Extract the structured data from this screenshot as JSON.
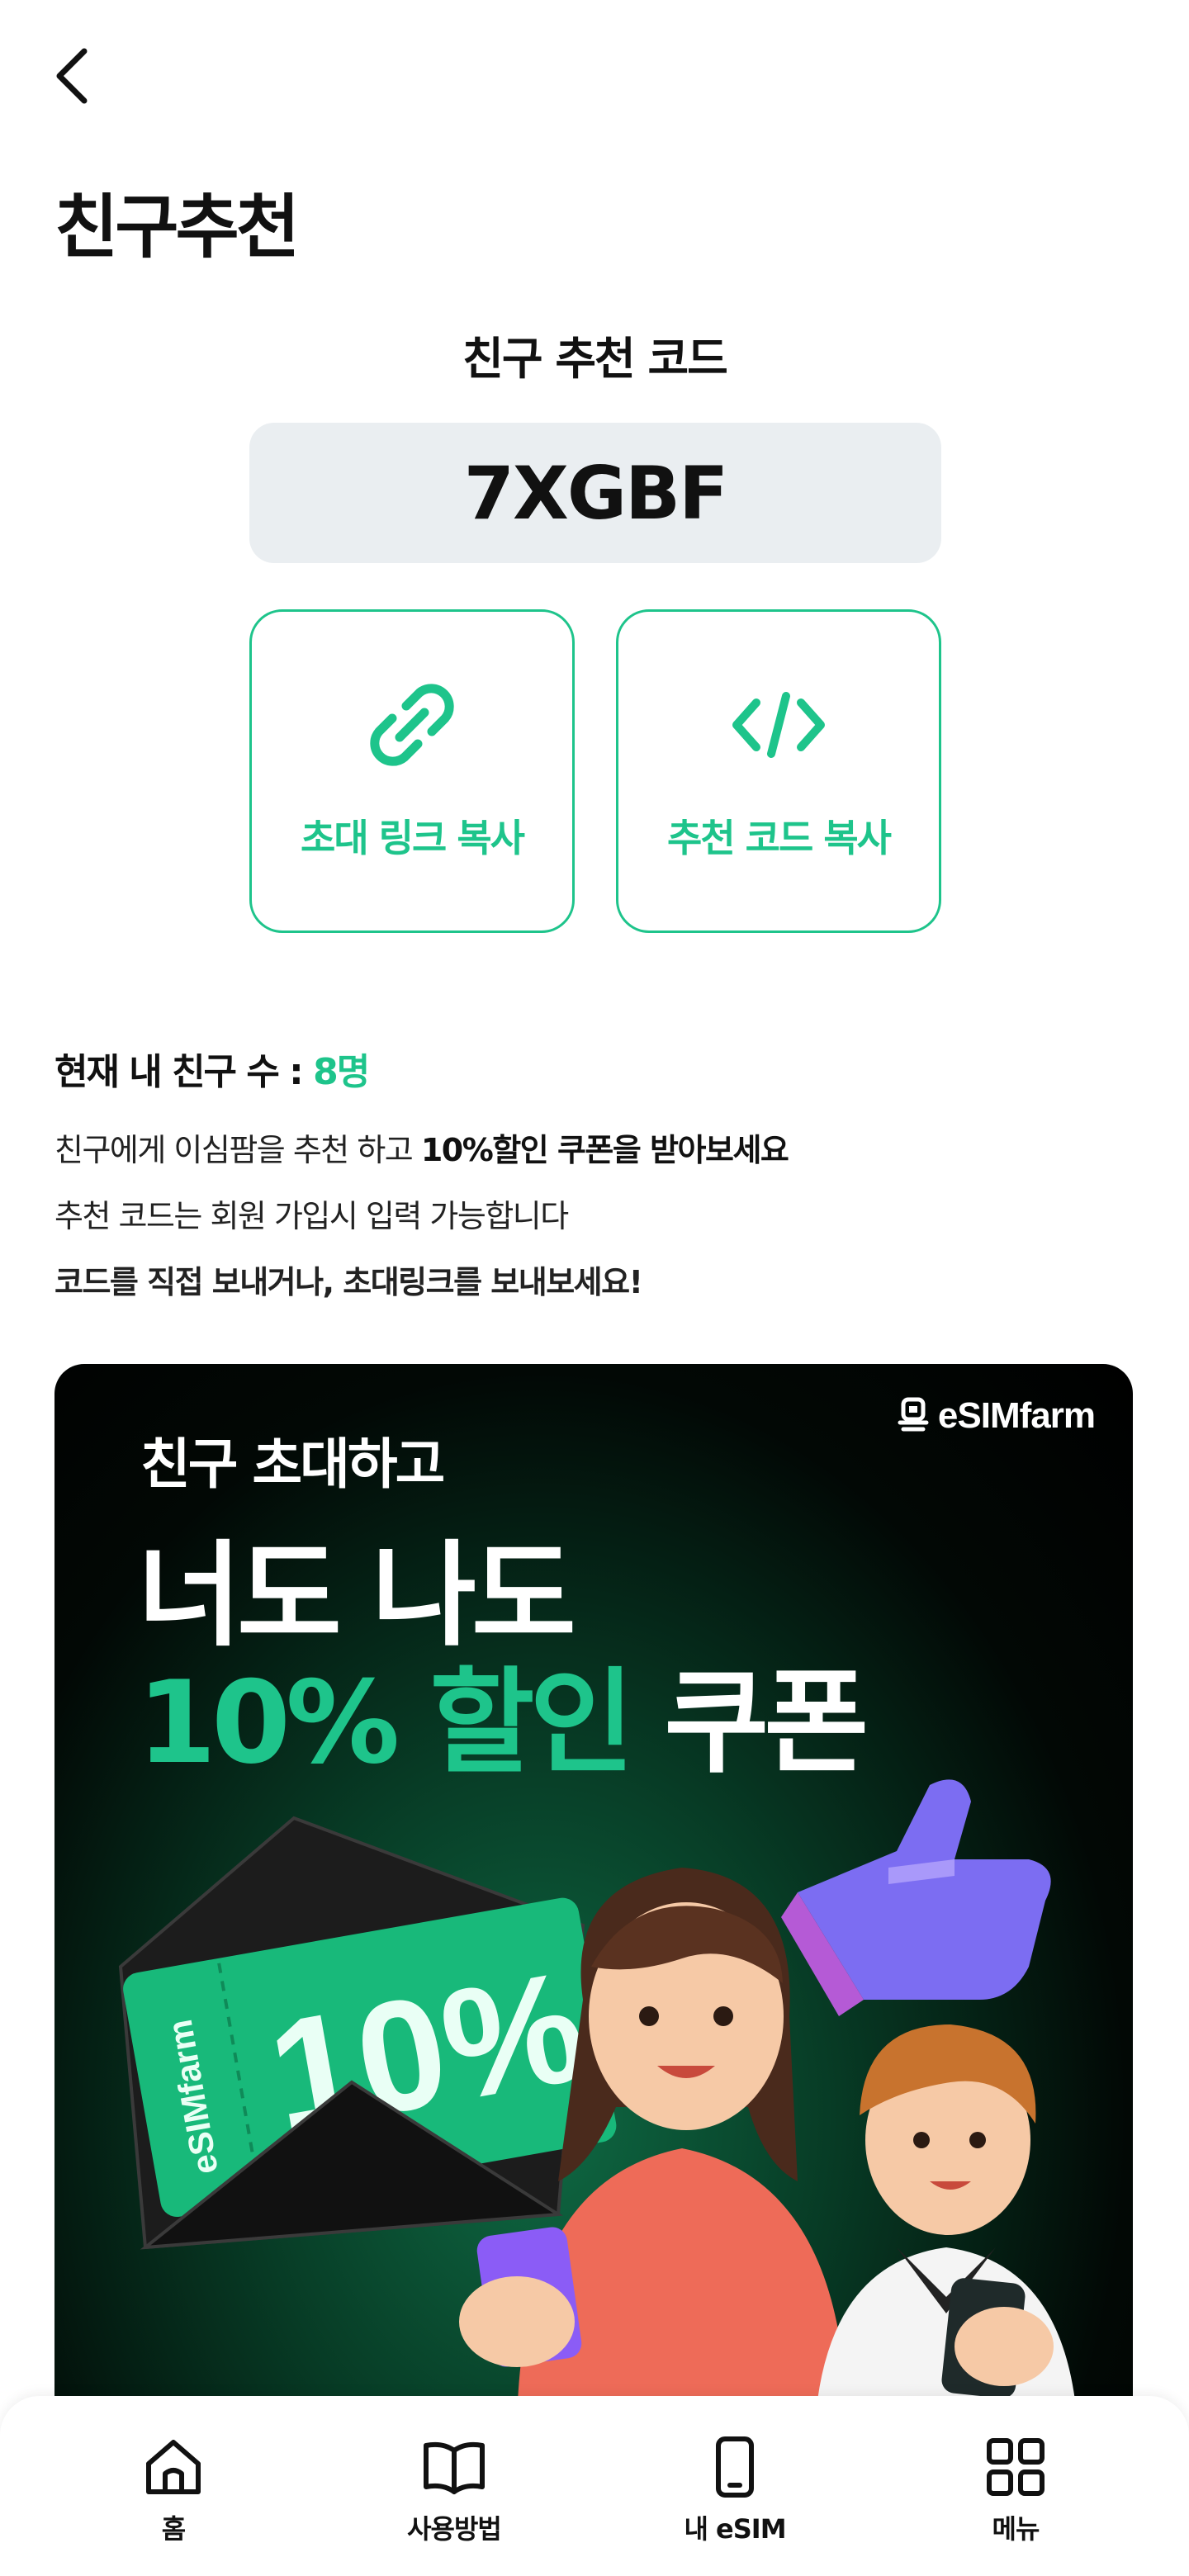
{
  "header": {
    "back_icon": "chevron-left-icon",
    "title": "친구추천"
  },
  "code_section": {
    "heading": "친구 추천 코드",
    "code": "7XGBF"
  },
  "actions": [
    {
      "label": "초대 링크 복사",
      "icon": "link-icon"
    },
    {
      "label": "추천 코드 복사",
      "icon": "code-icon"
    }
  ],
  "friend_count": {
    "label": "현재 내 친구 수 : ",
    "value": "8명"
  },
  "descriptions": {
    "line1_prefix": "친구에게 이심팜을 추천 하고 ",
    "line1_bold": "10%할인 쿠폰을 받아보세요",
    "line2": "추천 코드는 회원 가입시 입력 가능합니다",
    "line3": "코드를 직접 보내거나, 초대링크를 보내보세요!"
  },
  "banner": {
    "logo": "eSIMfarm",
    "line1": "친구 초대하고",
    "line2": "너도 나도",
    "line3_green": "10% 할인",
    "line3_white": " 쿠폰",
    "coupon_text": "10%",
    "coupon_brand": "eSIMfarm"
  },
  "bottom_nav": [
    {
      "label": "홈",
      "icon": "home-icon"
    },
    {
      "label": "사용방법",
      "icon": "book-icon"
    },
    {
      "label": "내 eSIM",
      "icon": "phone-icon"
    },
    {
      "label": "메뉴",
      "icon": "grid-icon"
    }
  ],
  "colors": {
    "accent": "#1ec48b",
    "code_bg": "#eaeef1",
    "text": "#111111"
  }
}
